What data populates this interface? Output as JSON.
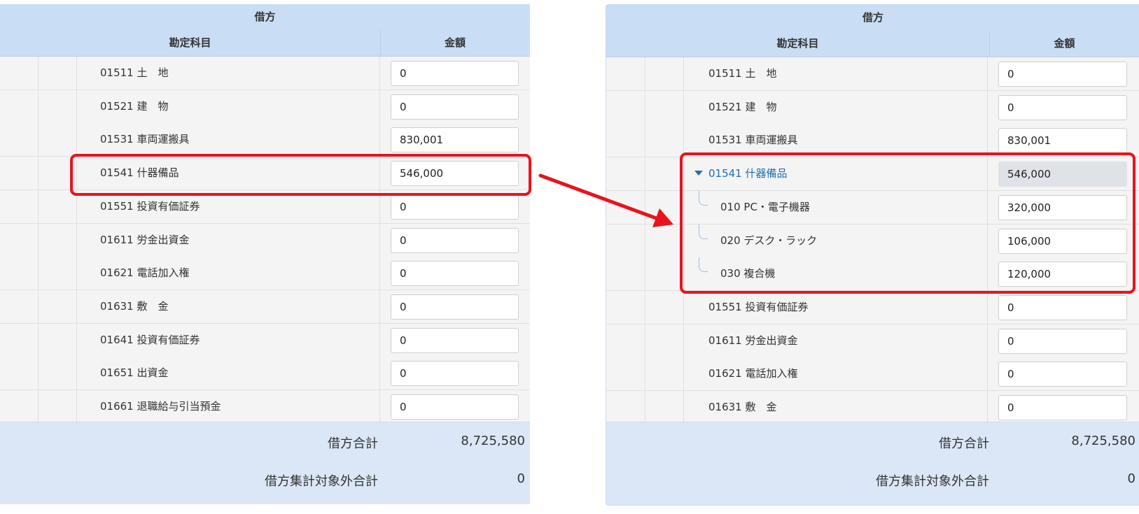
{
  "header": {
    "group_label": "借方",
    "account_col_label": "勘定科目",
    "amount_col_label": "金額"
  },
  "left_table": {
    "rows": [
      {
        "account": "01511 土　地",
        "amount": "0"
      },
      {
        "account": "01521 建　物",
        "amount": "0"
      },
      {
        "account": "01531 車両運搬具",
        "amount": "830,001"
      },
      {
        "account": "01541 什器備品",
        "amount": "546,000"
      },
      {
        "account": "01551 投資有価証券",
        "amount": "0"
      },
      {
        "account": "01611 労金出資金",
        "amount": "0"
      },
      {
        "account": "01621 電話加入権",
        "amount": "0"
      },
      {
        "account": "01631 敷　金",
        "amount": "0"
      },
      {
        "account": "01641 投資有価証券",
        "amount": "0"
      },
      {
        "account": "01651 出資金",
        "amount": "0"
      },
      {
        "account": "01661 退職給与引当預金",
        "amount": "0"
      }
    ]
  },
  "right_table": {
    "rows": [
      {
        "account": "01511 土　地",
        "amount": "0"
      },
      {
        "account": "01521 建　物",
        "amount": "0"
      },
      {
        "account": "01531 車両運搬具",
        "amount": "830,001"
      },
      {
        "account": "01541 什器備品",
        "amount": "546,000",
        "expanded": true
      },
      {
        "account": "010 PC・電子機器",
        "amount": "320,000",
        "child": true
      },
      {
        "account": "020 デスク・ラック",
        "amount": "106,000",
        "child": true
      },
      {
        "account": "030 複合機",
        "amount": "120,000",
        "child": true
      },
      {
        "account": "01551 投資有価証券",
        "amount": "0"
      },
      {
        "account": "01611 労金出資金",
        "amount": "0"
      },
      {
        "account": "01621 電話加入権",
        "amount": "0"
      },
      {
        "account": "01631 敷　金",
        "amount": "0"
      }
    ]
  },
  "footer": {
    "debit_total_label": "借方合計",
    "debit_total_value": "8,725,580",
    "excluded_total_label": "借方集計対象外合計",
    "excluded_total_value": "0"
  },
  "colors": {
    "header_bg": "#c9def4",
    "footer_bg": "#dbe7f6",
    "highlight": "#e8141d",
    "link_blue": "#1f6fb5"
  },
  "icons": [
    "caret-down-icon",
    "tree-branch-icon",
    "arrow-right-icon"
  ]
}
